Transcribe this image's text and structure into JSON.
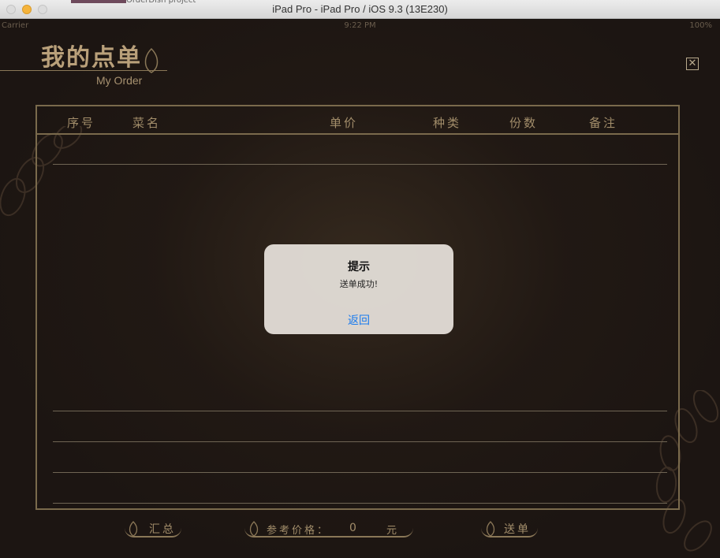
{
  "window": {
    "title": "iPad Pro - iPad Pro / iOS 9.3 (13E230)",
    "behind_tab": "OrderDish project"
  },
  "statusbar": {
    "left": "Carrier",
    "time": "9:22 PM",
    "right": "100%"
  },
  "header": {
    "title": "我的点单",
    "subtitle": "My Order",
    "close_icon": "close-icon"
  },
  "table": {
    "columns": [
      "序号",
      "菜名",
      "单价",
      "种类",
      "份数",
      "备注"
    ],
    "rows": []
  },
  "footer": {
    "summary_label": "汇总",
    "price_label": "参考价格：",
    "price_value": "0",
    "currency": "元",
    "submit_label": "送单"
  },
  "alert": {
    "title": "提示",
    "message": "送单成功!",
    "button": "返回",
    "button_color": "#1a7bef"
  },
  "colors": {
    "background": "#1c1512",
    "accent_gold": "#a28d6a"
  }
}
